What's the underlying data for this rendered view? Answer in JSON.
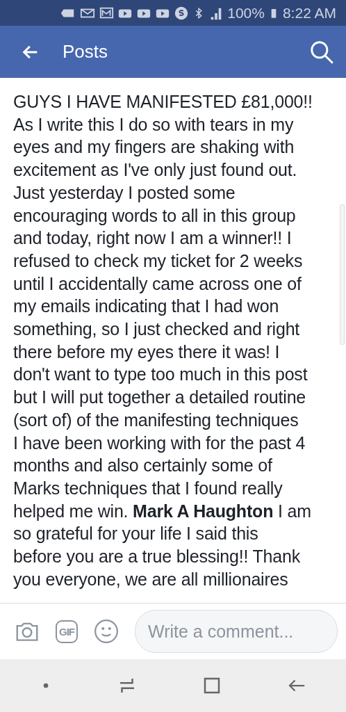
{
  "status_bar": {
    "battery": "100%",
    "time": "8:22 AM"
  },
  "header": {
    "title": "Posts"
  },
  "post": {
    "text": "GUYS I HAVE MANIFESTED £81,000!!\nAs I write this I do so with tears in my\neyes and my fingers are shaking with\nexcitement as I've only just found out.\nJust yesterday I posted some\nencouraging words to all in this group\nand today, right now I am a winner!! I\nrefused to check my ticket for 2 weeks\nuntil I accidentally came across one of\nmy emails indicating that I had won\nsomething, so I just checked and right\nthere before my eyes there it was! I\ndon't want to type too much in this post\nbut I will put together a detailed routine\n(sort of) of the manifesting techniques\nI have been working with for the past 4\nmonths and also certainly some of\nMarks techniques that I found really\nhelped me win.  **Mark A Haughton** I am\nso grateful for your life I said this\nbefore you are a true blessing!! Thank\nyou everyone, we are all millionaires"
  },
  "comment_bar": {
    "gif_label": "GIF",
    "placeholder": "Write a comment..."
  }
}
